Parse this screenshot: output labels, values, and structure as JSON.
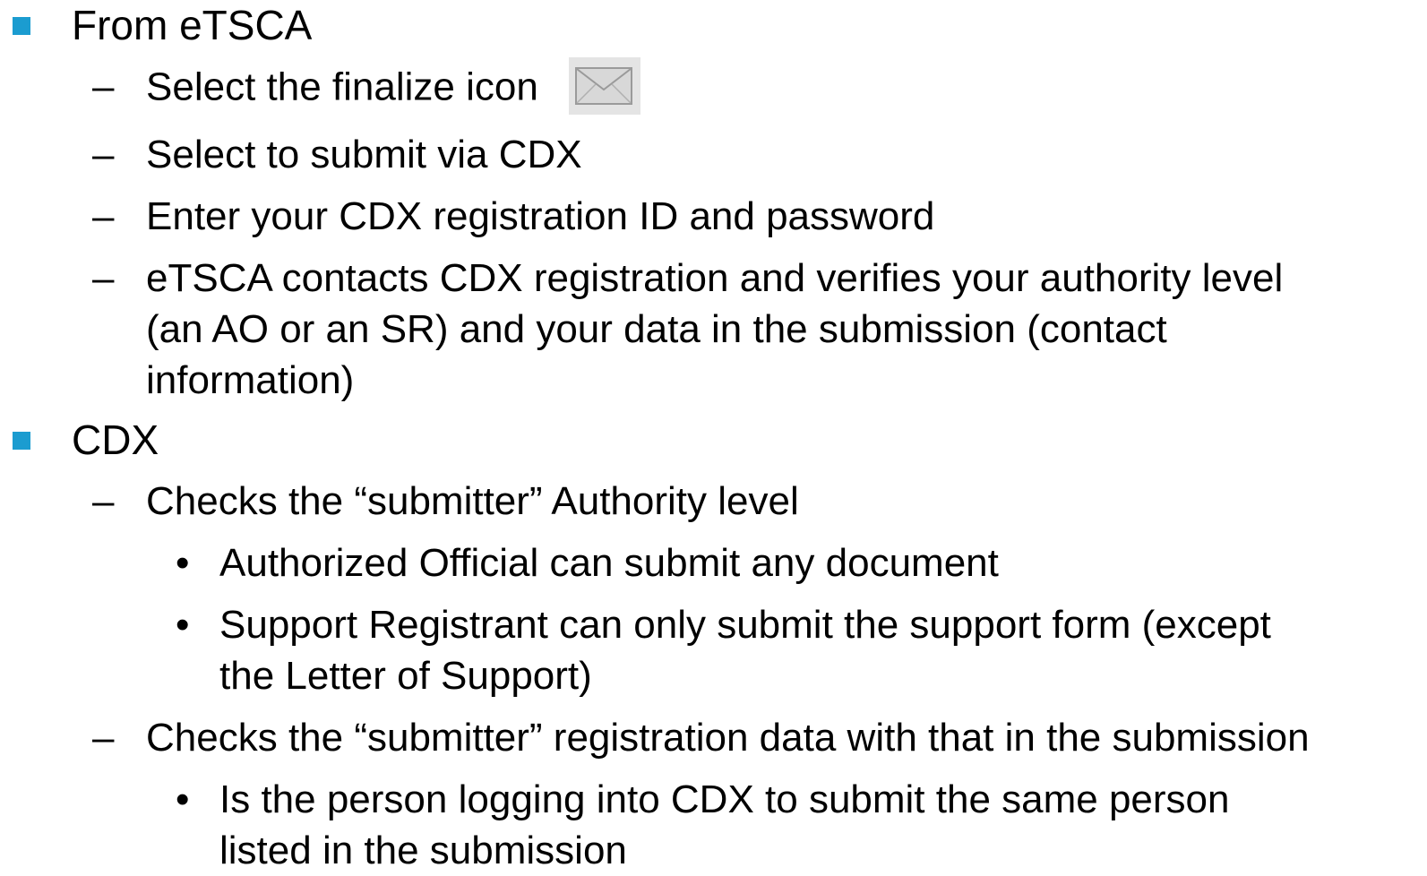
{
  "colors": {
    "bullet": "#1b9cd0",
    "text": "#000000",
    "icon_bg": "#e4e4e4"
  },
  "sections": [
    {
      "title": "From eTSCA",
      "items": [
        {
          "dash": "–",
          "lines": [
            "Select the finalize icon"
          ],
          "icon": "envelope-icon"
        },
        {
          "dash": "–",
          "lines": [
            "Select to submit via CDX"
          ]
        },
        {
          "dash": "–",
          "lines": [
            "Enter your CDX registration ID and password"
          ]
        },
        {
          "dash": "–",
          "lines": [
            "eTSCA contacts CDX registration and verifies your authority level",
            "(an AO or an SR) and your data in the submission (contact",
            "information)"
          ]
        }
      ]
    },
    {
      "title": "CDX",
      "items": [
        {
          "dash": "–",
          "lines": [
            "Checks the “submitter” Authority level"
          ],
          "subitems": [
            {
              "dot": "•",
              "lines": [
                "Authorized Official can submit any document"
              ]
            },
            {
              "dot": "•",
              "lines": [
                "Support Registrant can only submit the support form (except",
                "the Letter of Support)"
              ]
            }
          ]
        },
        {
          "dash": "–",
          "lines": [
            "Checks the “submitter” registration data with that in the submission"
          ],
          "subitems": [
            {
              "dot": "•",
              "lines": [
                "Is the person logging into CDX to submit the same person",
                "listed in the submission"
              ]
            }
          ]
        }
      ]
    }
  ]
}
